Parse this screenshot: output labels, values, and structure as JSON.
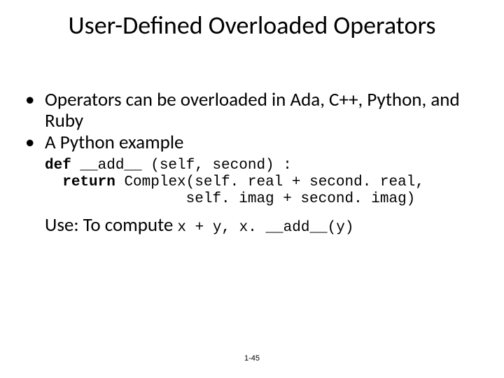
{
  "title": "User-Defined Overloaded Operators",
  "bullets": [
    "Operators can be overloaded in Ada, C++, Python, and Ruby",
    "A Python example"
  ],
  "code": {
    "kw_def": "def",
    "sig": " __add__ (self, second) :",
    "kw_return": "return",
    "line2_rest": " Complex(self. real + second. real,",
    "line3": "                self. imag + second. imag)"
  },
  "use": {
    "label": "Use: To compute ",
    "expr": "x + y, x. __add__(y)"
  },
  "footer": "1-45"
}
